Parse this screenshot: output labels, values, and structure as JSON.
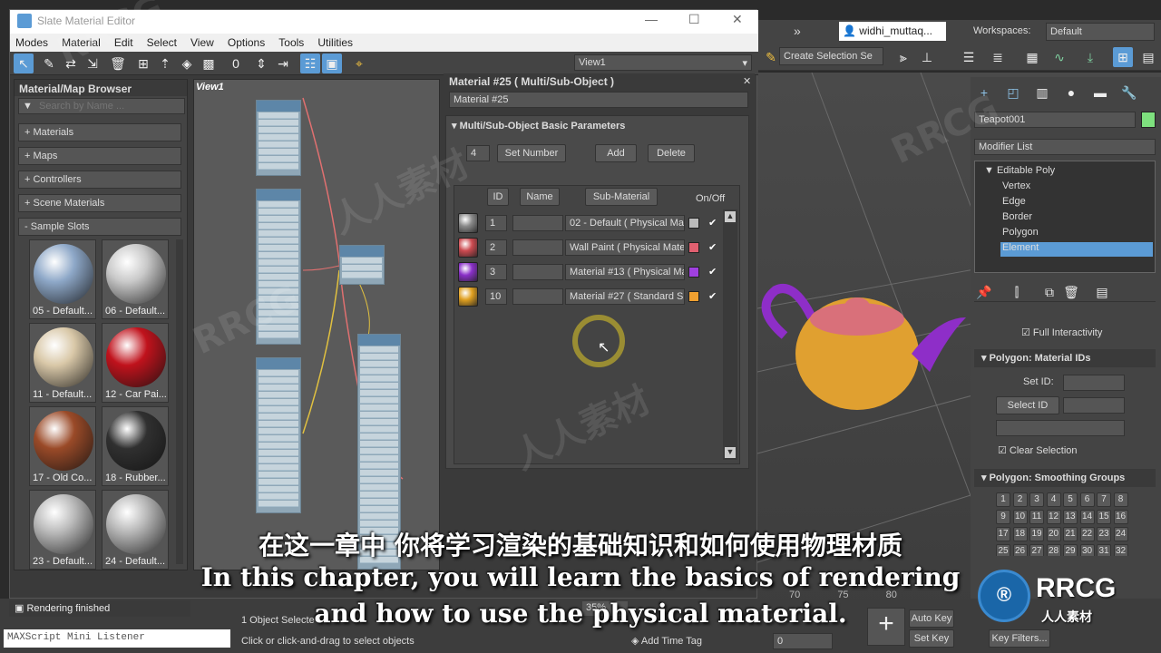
{
  "slate": {
    "title": "Slate Material Editor",
    "menu": [
      "Modes",
      "Material",
      "Edit",
      "Select",
      "View",
      "Options",
      "Tools",
      "Utilities"
    ],
    "view_dropdown": "View1"
  },
  "browser": {
    "title": "Material/Map Browser",
    "search_placeholder": "Search by Name ...",
    "rollouts": [
      "+ Materials",
      "+ Maps",
      "+ Controllers",
      "+ Scene Materials",
      "- Sample Slots"
    ],
    "slots": [
      {
        "label": "05 - Default...",
        "color": "#8ea8c8"
      },
      {
        "label": "06 - Default...",
        "color": "#c9c9c9"
      },
      {
        "label": "11 - Default...",
        "color": "#d9c8a8"
      },
      {
        "label": "12 - Car Pai...",
        "color": "#c0121c"
      },
      {
        "label": "17 - Old Co...",
        "color": "#9a4a28"
      },
      {
        "label": "18 - Rubber...",
        "color": "#303030"
      },
      {
        "label": "23 - Default...",
        "color": "#bbbbbb"
      },
      {
        "label": "24 - Default...",
        "color": "#b8b8b8"
      }
    ]
  },
  "view": {
    "tab_label": "View1"
  },
  "params": {
    "title": "Material #25  ( Multi/Sub-Object )",
    "name_field": "Material #25",
    "rollout_title": "Multi/Sub-Object Basic Parameters",
    "set_number_value": "4",
    "set_number_label": "Set Number",
    "add_label": "Add",
    "delete_label": "Delete",
    "col_id": "ID",
    "col_name": "Name",
    "col_sub": "Sub-Material",
    "col_onoff": "On/Off",
    "rows": [
      {
        "id": "1",
        "sub": "02 - Default  ( Physical Mat",
        "color": "#bbbbbb",
        "swatch": "#8a8a8a"
      },
      {
        "id": "2",
        "sub": "Wall Paint  ( Physical Mater",
        "color": "#e06070",
        "swatch": "#cc4a50"
      },
      {
        "id": "3",
        "sub": "Material #13  ( Physical Ma",
        "color": "#a040e0",
        "swatch": "#8a30c8"
      },
      {
        "id": "10",
        "sub": "Material #27  ( Standard Su",
        "color": "#f0a030",
        "swatch": "#e0a020"
      }
    ]
  },
  "max": {
    "user": "widhi_muttaq...",
    "workspaces_label": "Workspaces:",
    "workspace_value": "Default",
    "selection_set": "Create Selection Se",
    "object_name": "Teapot001",
    "modifier_list": "Modifier List",
    "stack": [
      "Editable Poly",
      "Vertex",
      "Edge",
      "Border",
      "Polygon",
      "Element"
    ],
    "full_interactivity": "Full Interactivity",
    "mat_ids_title": "Polygon: Material IDs",
    "set_id_label": "Set ID:",
    "select_id_label": "Select ID",
    "clear_selection_label": "Clear Selection",
    "smoothing_title": "Polygon: Smoothing Groups",
    "smoothing_numbers": [
      "1",
      "2",
      "3",
      "4",
      "5",
      "6",
      "7",
      "8",
      "9",
      "10",
      "11",
      "12",
      "13",
      "14",
      "15",
      "16",
      "17",
      "18",
      "19",
      "20",
      "21",
      "22",
      "23",
      "24",
      "25",
      "26",
      "27",
      "28",
      "29",
      "30",
      "31",
      "32"
    ],
    "accent_color": "#5b9bd5"
  },
  "status": {
    "rendering": "Rendering finished",
    "listener": "MAXScript Mini Listener",
    "objects_selected": "1 Object Selecte",
    "hint": "Click or click-and-drag to select objects",
    "zoom": "35%",
    "add_time_tag": "Add Time Tag",
    "auto_key": "Auto Key",
    "set_key": "Set Key",
    "key_filters": "Key Filters...",
    "frame_value": "0",
    "timeline_ticks": [
      "70",
      "75",
      "80"
    ]
  },
  "subtitles": {
    "cn": "在这一章中 你将学习渲染的基础知识和如何使用物理材质",
    "en1": "In this chapter, you will learn the basics of rendering",
    "en2": "and how to use the physical material."
  },
  "watermark": {
    "rrcg": "RRCG",
    "cn": "人人素材"
  }
}
